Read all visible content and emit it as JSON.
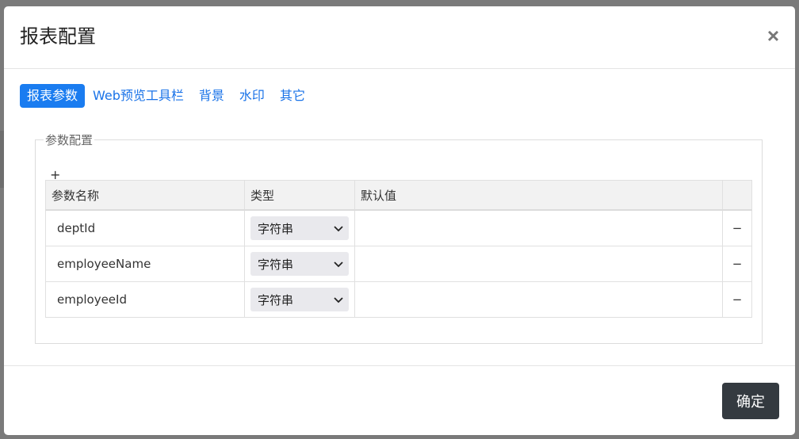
{
  "dialog": {
    "title": "报表配置",
    "close_label": "×"
  },
  "tabs": [
    {
      "label": "报表参数",
      "active": true
    },
    {
      "label": "Web预览工具栏",
      "active": false
    },
    {
      "label": "背景",
      "active": false
    },
    {
      "label": "水印",
      "active": false
    },
    {
      "label": "其它",
      "active": false
    }
  ],
  "params_section": {
    "legend": "参数配置",
    "add_label": "+",
    "columns": [
      "参数名称",
      "类型",
      "默认值",
      ""
    ],
    "rows": [
      {
        "name": "deptId",
        "type": "字符串",
        "default": "",
        "remove": "−"
      },
      {
        "name": "employeeName",
        "type": "字符串",
        "default": "",
        "remove": "−"
      },
      {
        "name": "employeeId",
        "type": "字符串",
        "default": "",
        "remove": "−"
      }
    ]
  },
  "footer": {
    "ok_label": "确定"
  },
  "icons": {
    "close": "close-icon",
    "select_arrow": "chevron-down-icon"
  },
  "colors": {
    "active_tab": "#1a7cf0",
    "link": "#1a73e8",
    "ok_button": "#343a40",
    "overlay": "#7a7a7a"
  }
}
